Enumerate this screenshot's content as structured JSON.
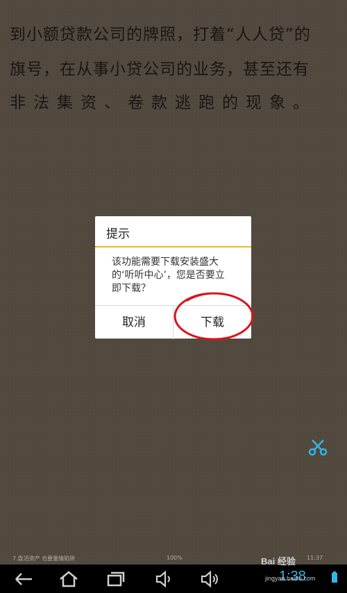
{
  "reader": {
    "lines": [
      "到小额贷款公司的牌照，打着“人人贷”的",
      "旗号，在从事小贷公司的业务，甚至还有",
      "非法集资、卷款逃跑的现象。"
    ]
  },
  "dialog": {
    "title": "提示",
    "message": "该功能需要下载安装盛大\n的‘听听中心’，您是否要立\n即下载？",
    "cancel_label": "取消",
    "download_label": "下载"
  },
  "annotation": {
    "circle_color": "#d9151b"
  },
  "status_bar": {
    "chapter": "7.盘活资产 也要量情陷阱",
    "progress": "100%",
    "time_small": "11:37"
  },
  "system": {
    "clock": "1:38",
    "accent": "#34b5e5"
  },
  "watermark": {
    "title": "Bai 经验",
    "subtitle": "jingyan.baidu.com"
  }
}
